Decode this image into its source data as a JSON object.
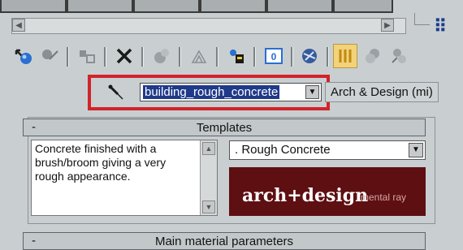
{
  "material_editor": {
    "toolbar": {
      "icons": [
        "put-to-scene-icon",
        "assign-material-icon",
        "reset-map-icon",
        "delete-icon",
        "make-unique-icon",
        "put-to-library-icon",
        "material-id-icon",
        "show-in-viewport-icon",
        "show-end-result-icon",
        "go-to-parent-icon",
        "go-forward-sibling-icon"
      ]
    },
    "material_name": "building_rough_concrete",
    "material_type": "Arch & Design (mi)",
    "highlight_color": "#d2232a"
  },
  "templates_rollout": {
    "title": "Templates",
    "collapse_symbol": "-",
    "description": "Concrete finished with a brush/broom giving a very rough appearance.",
    "selected_template": ".  Rough Concrete",
    "logo_text": "arch+design",
    "logo_subtext": "mental ray"
  },
  "main_params_rollout": {
    "title": "Main material parameters",
    "collapse_symbol": "-"
  }
}
